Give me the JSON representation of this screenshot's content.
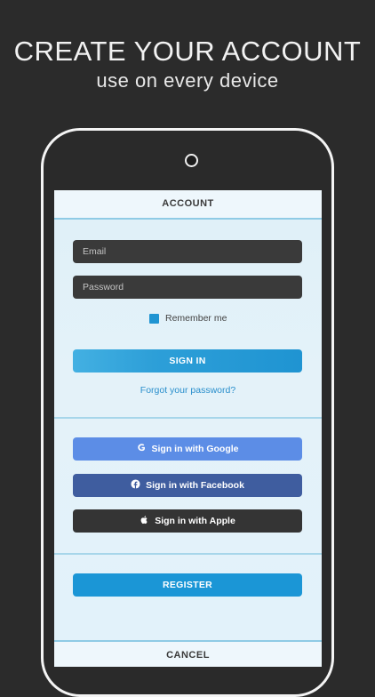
{
  "promo": {
    "headline": "CREATE YOUR ACCOUNT",
    "subline": "use on every device"
  },
  "screen": {
    "title": "ACCOUNT",
    "email_placeholder": "Email",
    "password_placeholder": "Password",
    "remember_label": "Remember me",
    "remember_checked": true,
    "signin_label": "SIGN IN",
    "forgot_label": "Forgot your password?",
    "google_label": "Sign in with Google",
    "facebook_label": "Sign in with Facebook",
    "apple_label": "Sign in with Apple",
    "register_label": "REGISTER",
    "cancel_label": "CANCEL"
  },
  "colors": {
    "background": "#2b2b2b",
    "accent": "#1f94d2",
    "google": "#5c8de6",
    "facebook": "#3f5d9f",
    "apple": "#343434"
  },
  "icons": [
    "google-icon",
    "facebook-icon",
    "apple-icon"
  ]
}
